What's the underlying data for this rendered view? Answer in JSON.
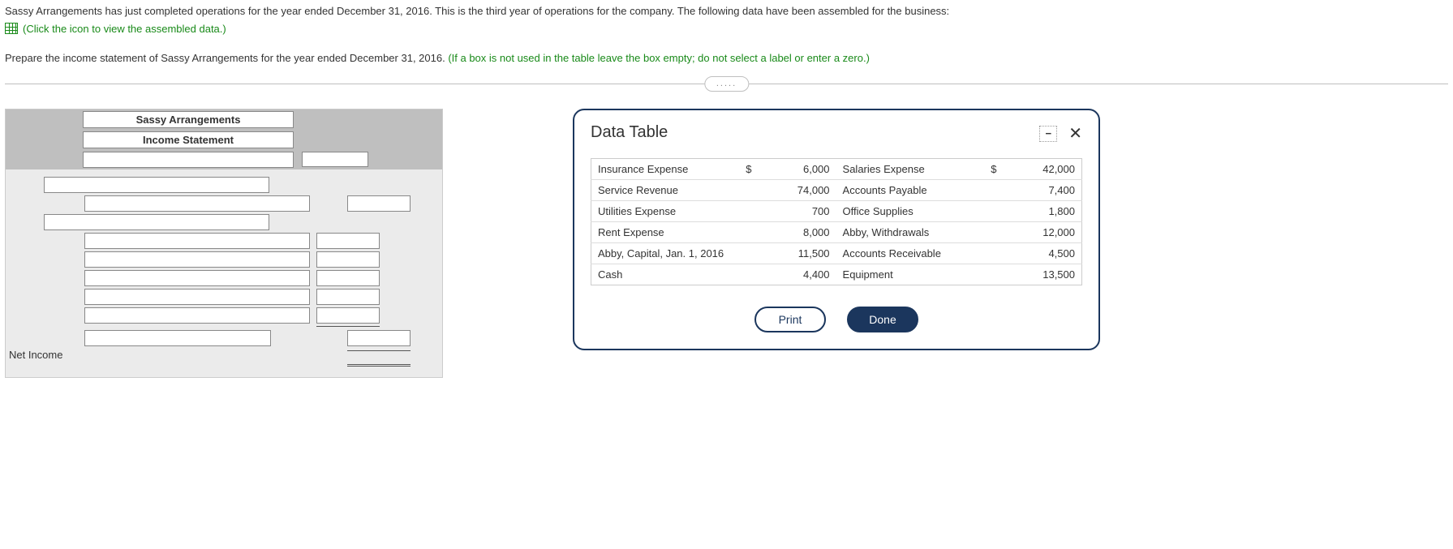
{
  "intro": {
    "line1": "Sassy Arrangements has just completed operations for the year ended December 31, 2016. This is the third year of operations for the company. The following data have been assembled for the business:",
    "click_text": "(Click the icon to view the assembled data.)",
    "prep_prefix": "Prepare the income statement of Sassy Arrangements for the year ended December 31, 2016. ",
    "prep_note": "(If a box is not used in the table leave the box empty; do not select a label or enter a zero.)"
  },
  "divider_dots": ".....",
  "statement": {
    "header1": "Sassy Arrangements",
    "header2": "Income Statement",
    "net_income_label": "Net Income"
  },
  "dialog": {
    "title": "Data Table",
    "min_glyph": "−",
    "close_glyph": "✕",
    "print_label": "Print",
    "done_label": "Done",
    "currency": "$",
    "rows": [
      {
        "l_name": "Insurance Expense",
        "l_cur": "$",
        "l_val": "6,000",
        "r_name": "Salaries Expense",
        "r_cur": "$",
        "r_val": "42,000"
      },
      {
        "l_name": "Service Revenue",
        "l_cur": "",
        "l_val": "74,000",
        "r_name": "Accounts Payable",
        "r_cur": "",
        "r_val": "7,400"
      },
      {
        "l_name": "Utilities Expense",
        "l_cur": "",
        "l_val": "700",
        "r_name": "Office Supplies",
        "r_cur": "",
        "r_val": "1,800"
      },
      {
        "l_name": "Rent Expense",
        "l_cur": "",
        "l_val": "8,000",
        "r_name": "Abby, Withdrawals",
        "r_cur": "",
        "r_val": "12,000"
      },
      {
        "l_name": "Abby, Capital, Jan. 1, 2016",
        "l_cur": "",
        "l_val": "11,500",
        "r_name": "Accounts Receivable",
        "r_cur": "",
        "r_val": "4,500"
      },
      {
        "l_name": "Cash",
        "l_cur": "",
        "l_val": "4,400",
        "r_name": "Equipment",
        "r_cur": "",
        "r_val": "13,500"
      }
    ]
  }
}
